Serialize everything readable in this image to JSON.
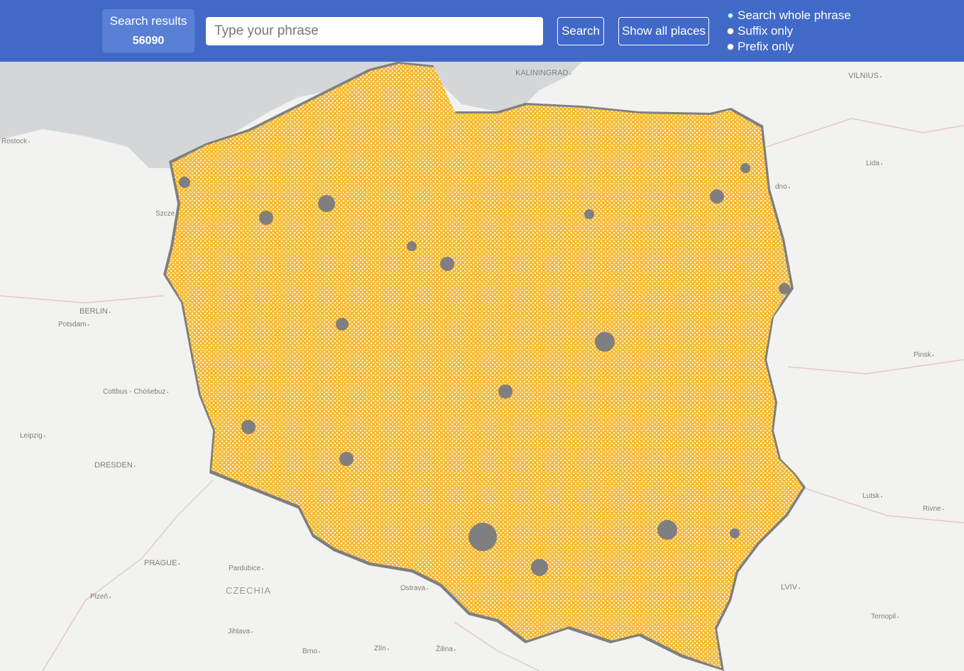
{
  "header": {
    "results_label": "Search results",
    "results_count": "56090",
    "search_placeholder": "Type your phrase",
    "search_value": "",
    "search_button": "Search",
    "show_all_button": "Show all places",
    "modes": [
      {
        "label": "Search whole phrase",
        "checked": true
      },
      {
        "label": "Suffix only",
        "checked": false
      },
      {
        "label": "Prefix only",
        "checked": false
      }
    ]
  },
  "map": {
    "marker_color": "#f7bc37",
    "marker_border": "#ffffff",
    "country_fill": "#7f7f7f",
    "sea_color": "#d4d7da",
    "land_color": "#f2f2f0",
    "labels": {
      "kaliningrad": "KALININGRAD",
      "vilnius": "VILNIUS",
      "rostock": "Rostock",
      "lida": "Lida",
      "grodno": "dno",
      "szczecin": "Szcze",
      "berlin": "BERLIN",
      "potsdam": "Potsdam",
      "pinsk": "Pinsk",
      "cottbus": "Cottbus - Chóśebuz",
      "leipzig": "Leipzig",
      "dresden": "DRESDEN",
      "lutsk": "Lutsk",
      "rivne": "Rivne",
      "prague": "PRAGUE",
      "pardubice": "Pardubice",
      "czechia": "CZECHIA",
      "ostrava": "Ostrava",
      "lviv": "LVIV",
      "plzen": "Plzeň",
      "ternopil": "Ternopil",
      "jihlava": "Jihlava",
      "brno": "Brno",
      "zlin": "Zlín",
      "zilina": "Žilina"
    }
  }
}
